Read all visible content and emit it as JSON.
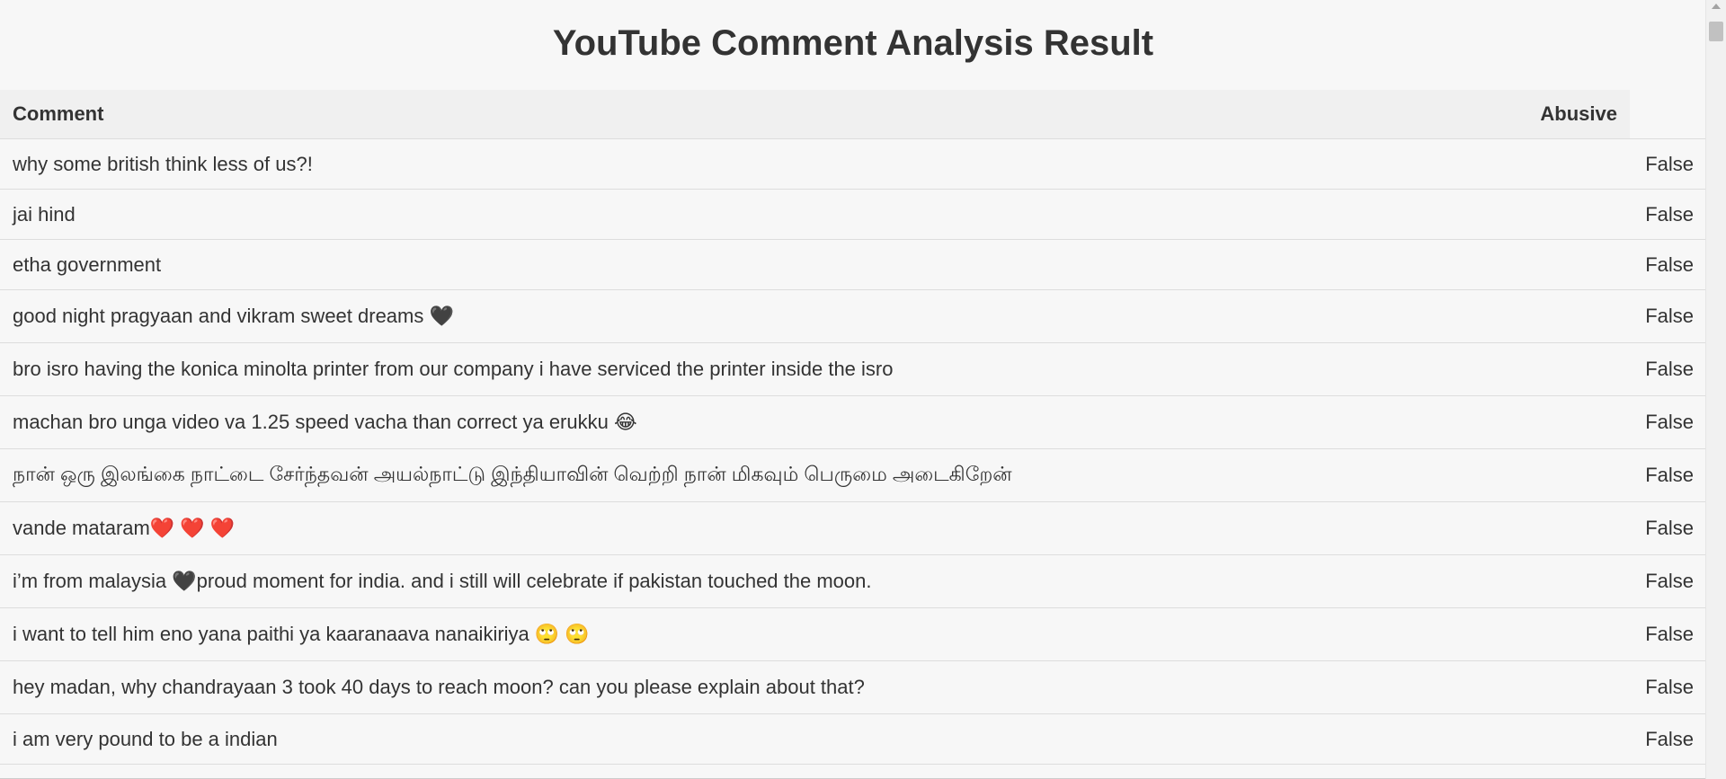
{
  "page": {
    "title": "YouTube Comment Analysis Result"
  },
  "table": {
    "headers": {
      "comment": "Comment",
      "abusive": "Abusive"
    },
    "rows": [
      {
        "comment": "why some british think less of us?!",
        "abusive": "False"
      },
      {
        "comment": "jai hind",
        "abusive": "False"
      },
      {
        "comment": "etha government",
        "abusive": "False"
      },
      {
        "comment": "good night pragyaan and vikram sweet dreams 🖤",
        "abusive": "False"
      },
      {
        "comment": "bro isro having the konica minolta printer from our company i have serviced the printer inside the isro",
        "abusive": "False"
      },
      {
        "comment": "machan bro unga video va 1.25 speed vacha than correct ya erukku 😂",
        "abusive": "False"
      },
      {
        "comment": "நான் ஒரு இலங்கை நாட்டை சேர்ந்தவன் அயல்நாட்டு இந்தியாவின் வெற்றி நான் மிகவும் பெருமை அடைகிறேன்",
        "abusive": "False"
      },
      {
        "comment": "vande mataram❤️ ❤️ ❤️",
        "abusive": "False"
      },
      {
        "comment": "i’m from malaysia 🖤proud moment for india. and i still will celebrate if pakistan touched the moon.",
        "abusive": "False"
      },
      {
        "comment": "i want to tell him eno yana paithi ya kaaranaava nanaikiriya 🙄 🙄",
        "abusive": "False"
      },
      {
        "comment": "hey madan, why chandrayaan 3 took 40 days to reach moon? can you please explain about that?",
        "abusive": "False"
      },
      {
        "comment": "i am very pound to be a indian",
        "abusive": "False"
      },
      {
        "comment": "",
        "abusive": "False"
      }
    ]
  }
}
